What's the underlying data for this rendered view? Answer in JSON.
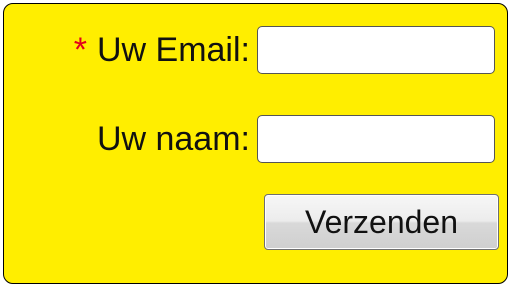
{
  "form": {
    "email": {
      "required_marker": "*",
      "label": "Uw Email:",
      "value": "",
      "placeholder": ""
    },
    "name": {
      "label": "Uw naam:",
      "value": "",
      "placeholder": ""
    },
    "submit_label": "Verzenden"
  },
  "colors": {
    "panel_background": "#ffee00",
    "required_marker": "#e3001b"
  }
}
